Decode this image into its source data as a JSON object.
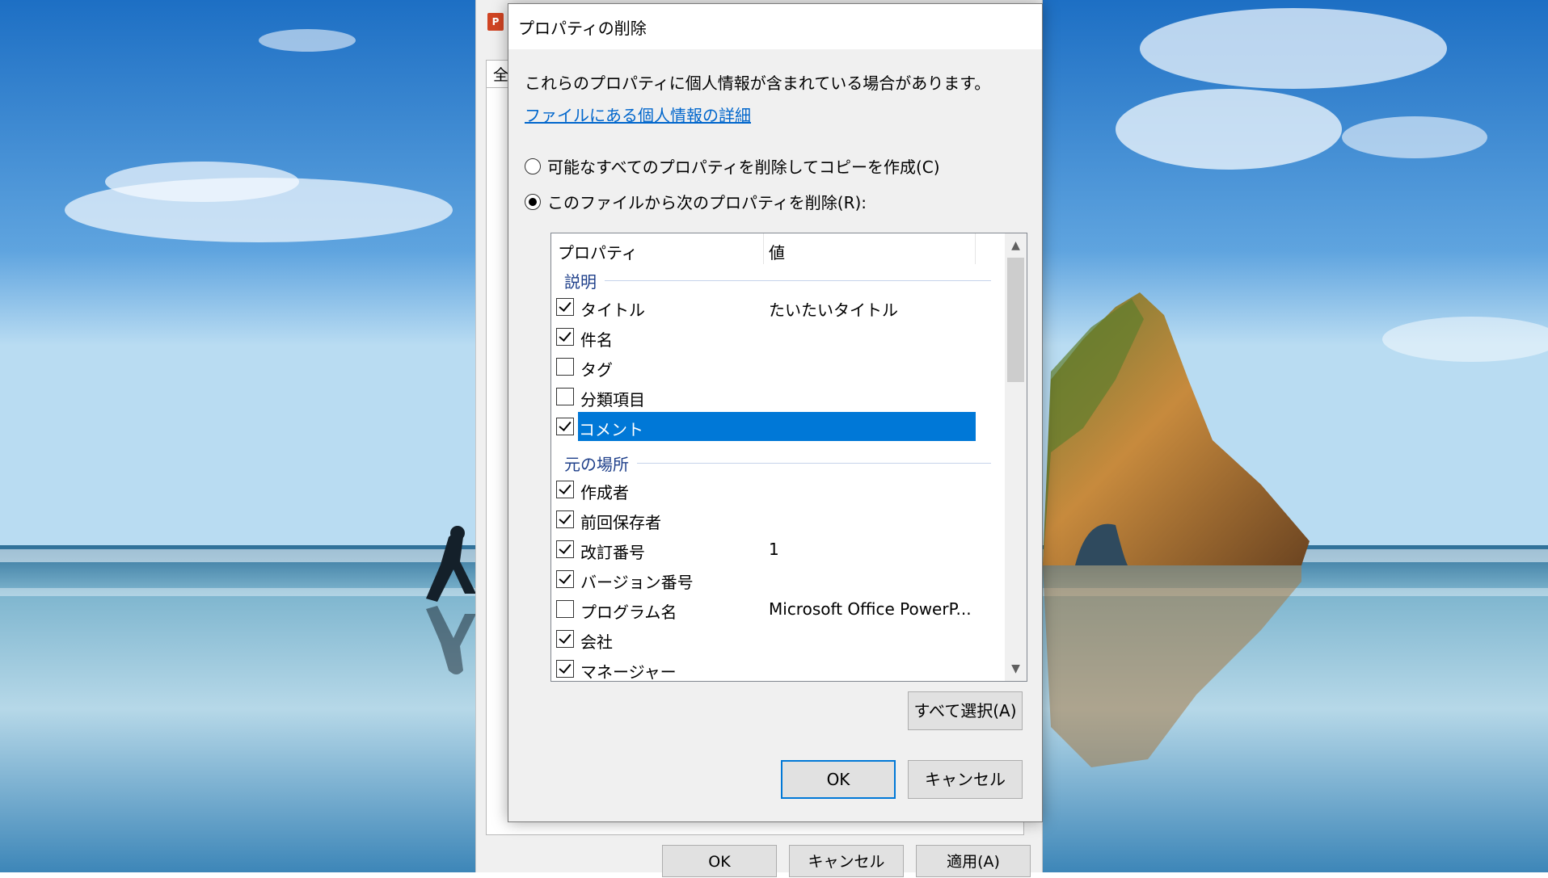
{
  "parent_window": {
    "app_icon_letter": "P",
    "tab_label": "全",
    "buttons": [
      "OK",
      "キャンセル",
      "適用(A)"
    ]
  },
  "dialog": {
    "title": "プロパティの削除",
    "intro": "これらのプロパティに個人情報が含まれている場合があります。",
    "detail_link": "ファイルにある個人情報の詳細",
    "radio_copy_label": "可能なすべてのプロパティを削除してコピーを作成(C)",
    "radio_remove_label": "このファイルから次のプロパティを削除(R):",
    "selected_radio": "remove",
    "columns": {
      "property": "プロパティ",
      "value": "値"
    },
    "groups": [
      {
        "name": "説明",
        "items": [
          {
            "label": "タイトル",
            "value": "たいたいタイトル",
            "checked": true
          },
          {
            "label": "件名",
            "value": "",
            "checked": true
          },
          {
            "label": "タグ",
            "value": "",
            "checked": false
          },
          {
            "label": "分類項目",
            "value": "",
            "checked": false
          },
          {
            "label": "コメント",
            "value": "",
            "checked": true,
            "selected": true
          }
        ]
      },
      {
        "name": "元の場所",
        "items": [
          {
            "label": "作成者",
            "value": "",
            "checked": true
          },
          {
            "label": "前回保存者",
            "value": "",
            "checked": true
          },
          {
            "label": "改訂番号",
            "value": "1",
            "checked": true
          },
          {
            "label": "バージョン番号",
            "value": "",
            "checked": true
          },
          {
            "label": "プログラム名",
            "value": "Microsoft Office PowerP...",
            "checked": false
          },
          {
            "label": "会社",
            "value": "",
            "checked": true
          },
          {
            "label": "マネージャー",
            "value": "",
            "checked": true
          }
        ]
      }
    ],
    "select_all_button": "すべて選択(A)",
    "ok_button": "OK",
    "cancel_button": "キャンセル"
  },
  "colors": {
    "selection": "#0078d7",
    "link": "#0066cc",
    "group_header": "#1e3f8a"
  }
}
